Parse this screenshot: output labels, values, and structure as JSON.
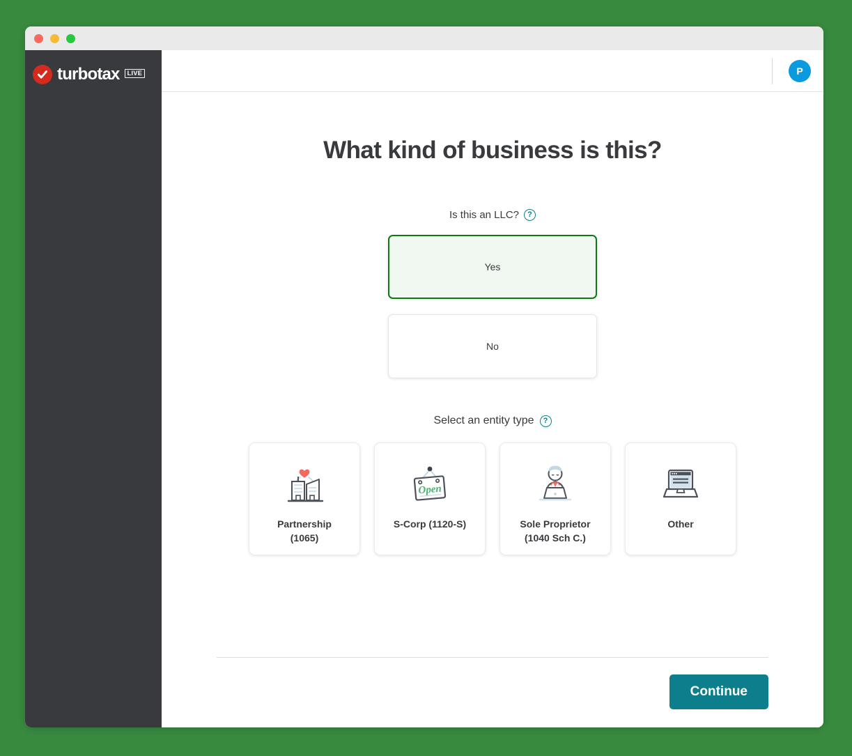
{
  "window": {
    "controls": [
      {
        "name": "close",
        "color": "#f9695f"
      },
      {
        "name": "minimize",
        "color": "#f8bb38"
      },
      {
        "name": "maximize",
        "color": "#27c93f"
      }
    ]
  },
  "sidebar": {
    "logo_word": "turbotax",
    "logo_badge": "LIVE",
    "background": "#393a3d"
  },
  "topbar": {
    "avatar_initial": "P",
    "avatar_color": "#0a9ae0"
  },
  "main": {
    "title": "What kind of business is this?",
    "llc_question": {
      "label": "Is this an LLC?",
      "help_glyph": "?",
      "options": [
        {
          "label": "Yes",
          "selected": true
        },
        {
          "label": "No",
          "selected": false
        }
      ],
      "selected_border": "#0b7a12",
      "selected_fill": "#f1f8f2"
    },
    "entity_section": {
      "label": "Select an entity type",
      "help_glyph": "?",
      "options": [
        {
          "label": "Partnership\n(1065)",
          "icon": "two-buildings-heart-icon"
        },
        {
          "label": "S-Corp (1120-S)",
          "icon": "open-sign-icon"
        },
        {
          "label": "Sole Proprietor\n(1040 Sch C.)",
          "icon": "person-laptop-icon"
        },
        {
          "label": "Other",
          "icon": "laptop-browser-icon"
        }
      ]
    }
  },
  "footer": {
    "continue_label": "Continue",
    "continue_color": "#0d7e8c"
  },
  "page": {
    "background": "#388a3f"
  }
}
